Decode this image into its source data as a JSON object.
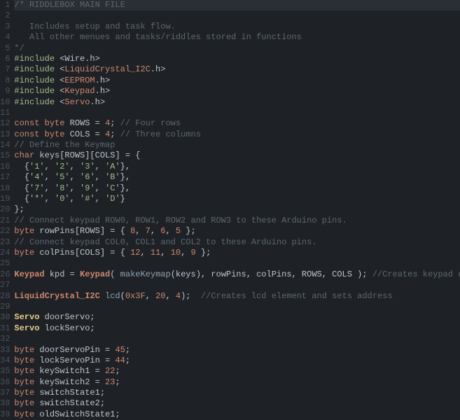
{
  "lines": [
    {
      "n": 1,
      "hl": true,
      "tokens": [
        {
          "t": "/* RIDDLEBOX MAIN FILE",
          "c": "c-comment"
        }
      ]
    },
    {
      "n": 2,
      "tokens": []
    },
    {
      "n": 3,
      "tokens": [
        {
          "t": "   Includes setup and task flow.",
          "c": "c-comment"
        }
      ]
    },
    {
      "n": 4,
      "tokens": [
        {
          "t": "   All other menues and tasks/riddles stored in functions",
          "c": "c-comment"
        }
      ]
    },
    {
      "n": 5,
      "tokens": [
        {
          "t": "*/",
          "c": "c-comment"
        }
      ]
    },
    {
      "n": 6,
      "tokens": [
        {
          "t": "#include ",
          "c": "c-pre"
        },
        {
          "t": "<",
          "c": "c-op"
        },
        {
          "t": "Wire",
          "c": "c-libw"
        },
        {
          "t": ".h",
          "c": "c-libw"
        },
        {
          "t": ">",
          "c": "c-op"
        }
      ]
    },
    {
      "n": 7,
      "tokens": [
        {
          "t": "#include ",
          "c": "c-pre"
        },
        {
          "t": "<",
          "c": "c-op"
        },
        {
          "t": "LiquidCrystal_I2C",
          "c": "c-lib"
        },
        {
          "t": ".h",
          "c": "c-libw"
        },
        {
          "t": ">",
          "c": "c-op"
        }
      ]
    },
    {
      "n": 8,
      "tokens": [
        {
          "t": "#include ",
          "c": "c-pre"
        },
        {
          "t": "<",
          "c": "c-op"
        },
        {
          "t": "EEPROM",
          "c": "c-lib"
        },
        {
          "t": ".h",
          "c": "c-libw"
        },
        {
          "t": ">",
          "c": "c-op"
        }
      ]
    },
    {
      "n": 9,
      "tokens": [
        {
          "t": "#include ",
          "c": "c-pre"
        },
        {
          "t": "<",
          "c": "c-op"
        },
        {
          "t": "Keypad",
          "c": "c-lib"
        },
        {
          "t": ".h",
          "c": "c-libw"
        },
        {
          "t": ">",
          "c": "c-op"
        }
      ]
    },
    {
      "n": 10,
      "tokens": [
        {
          "t": "#include ",
          "c": "c-pre"
        },
        {
          "t": "<",
          "c": "c-op"
        },
        {
          "t": "Servo",
          "c": "c-lib"
        },
        {
          "t": ".h",
          "c": "c-libw"
        },
        {
          "t": ">",
          "c": "c-op"
        }
      ]
    },
    {
      "n": 11,
      "tokens": []
    },
    {
      "n": 12,
      "tokens": [
        {
          "t": "const ",
          "c": "c-keyword"
        },
        {
          "t": "byte",
          "c": "c-type"
        },
        {
          "t": " ROWS ",
          "c": "c-id"
        },
        {
          "t": "=",
          "c": "c-op"
        },
        {
          "t": " ",
          "c": "c-id"
        },
        {
          "t": "4",
          "c": "c-num"
        },
        {
          "t": "; ",
          "c": "c-op"
        },
        {
          "t": "// Four rows",
          "c": "c-comment"
        }
      ]
    },
    {
      "n": 13,
      "tokens": [
        {
          "t": "const ",
          "c": "c-keyword"
        },
        {
          "t": "byte",
          "c": "c-type"
        },
        {
          "t": " COLS ",
          "c": "c-id"
        },
        {
          "t": "=",
          "c": "c-op"
        },
        {
          "t": " ",
          "c": "c-id"
        },
        {
          "t": "4",
          "c": "c-num"
        },
        {
          "t": "; ",
          "c": "c-op"
        },
        {
          "t": "// Three columns",
          "c": "c-comment"
        }
      ]
    },
    {
      "n": 14,
      "tokens": [
        {
          "t": "// Define the Keymap",
          "c": "c-comment"
        }
      ]
    },
    {
      "n": 15,
      "tokens": [
        {
          "t": "char",
          "c": "c-type"
        },
        {
          "t": " keys[ROWS][COLS] ",
          "c": "c-id"
        },
        {
          "t": "=",
          "c": "c-op"
        },
        {
          "t": " {",
          "c": "c-op"
        }
      ]
    },
    {
      "n": 16,
      "tokens": [
        {
          "t": "  {",
          "c": "c-op"
        },
        {
          "t": "'1'",
          "c": "c-str"
        },
        {
          "t": ", ",
          "c": "c-op"
        },
        {
          "t": "'2'",
          "c": "c-str"
        },
        {
          "t": ", ",
          "c": "c-op"
        },
        {
          "t": "'3'",
          "c": "c-str"
        },
        {
          "t": ", ",
          "c": "c-op"
        },
        {
          "t": "'A'",
          "c": "c-str"
        },
        {
          "t": "},",
          "c": "c-op"
        }
      ]
    },
    {
      "n": 17,
      "tokens": [
        {
          "t": "  {",
          "c": "c-op"
        },
        {
          "t": "'4'",
          "c": "c-str"
        },
        {
          "t": ", ",
          "c": "c-op"
        },
        {
          "t": "'5'",
          "c": "c-str"
        },
        {
          "t": ", ",
          "c": "c-op"
        },
        {
          "t": "'6'",
          "c": "c-str"
        },
        {
          "t": ", ",
          "c": "c-op"
        },
        {
          "t": "'B'",
          "c": "c-str"
        },
        {
          "t": "},",
          "c": "c-op"
        }
      ]
    },
    {
      "n": 18,
      "tokens": [
        {
          "t": "  {",
          "c": "c-op"
        },
        {
          "t": "'7'",
          "c": "c-str"
        },
        {
          "t": ", ",
          "c": "c-op"
        },
        {
          "t": "'8'",
          "c": "c-str"
        },
        {
          "t": ", ",
          "c": "c-op"
        },
        {
          "t": "'9'",
          "c": "c-str"
        },
        {
          "t": ", ",
          "c": "c-op"
        },
        {
          "t": "'C'",
          "c": "c-str"
        },
        {
          "t": "},",
          "c": "c-op"
        }
      ]
    },
    {
      "n": 19,
      "tokens": [
        {
          "t": "  {",
          "c": "c-op"
        },
        {
          "t": "'*'",
          "c": "c-str"
        },
        {
          "t": ", ",
          "c": "c-op"
        },
        {
          "t": "'0'",
          "c": "c-str"
        },
        {
          "t": ", ",
          "c": "c-op"
        },
        {
          "t": "'#'",
          "c": "c-str"
        },
        {
          "t": ", ",
          "c": "c-op"
        },
        {
          "t": "'D'",
          "c": "c-str"
        },
        {
          "t": "}",
          "c": "c-op"
        }
      ]
    },
    {
      "n": 20,
      "tokens": [
        {
          "t": "};",
          "c": "c-op"
        }
      ]
    },
    {
      "n": 21,
      "tokens": [
        {
          "t": "// Connect keypad ROW0, ROW1, ROW2 and ROW3 to these Arduino pins.",
          "c": "c-comment"
        }
      ]
    },
    {
      "n": 22,
      "tokens": [
        {
          "t": "byte",
          "c": "c-type"
        },
        {
          "t": " rowPins[ROWS] ",
          "c": "c-id"
        },
        {
          "t": "=",
          "c": "c-op"
        },
        {
          "t": " { ",
          "c": "c-op"
        },
        {
          "t": "8",
          "c": "c-num"
        },
        {
          "t": ", ",
          "c": "c-op"
        },
        {
          "t": "7",
          "c": "c-num"
        },
        {
          "t": ", ",
          "c": "c-op"
        },
        {
          "t": "6",
          "c": "c-num"
        },
        {
          "t": ", ",
          "c": "c-op"
        },
        {
          "t": "5",
          "c": "c-num"
        },
        {
          "t": " };",
          "c": "c-op"
        }
      ]
    },
    {
      "n": 23,
      "tokens": [
        {
          "t": "// Connect keypad COL0, COL1 and COL2 to these Arduino pins.",
          "c": "c-comment"
        }
      ]
    },
    {
      "n": 24,
      "tokens": [
        {
          "t": "byte",
          "c": "c-type"
        },
        {
          "t": " colPins[COLS] ",
          "c": "c-id"
        },
        {
          "t": "=",
          "c": "c-op"
        },
        {
          "t": " { ",
          "c": "c-op"
        },
        {
          "t": "12",
          "c": "c-num"
        },
        {
          "t": ", ",
          "c": "c-op"
        },
        {
          "t": "11",
          "c": "c-num"
        },
        {
          "t": ", ",
          "c": "c-op"
        },
        {
          "t": "10",
          "c": "c-num"
        },
        {
          "t": ", ",
          "c": "c-op"
        },
        {
          "t": "9",
          "c": "c-num"
        },
        {
          "t": " };",
          "c": "c-op"
        }
      ]
    },
    {
      "n": 25,
      "tokens": []
    },
    {
      "n": 26,
      "tokens": [
        {
          "t": "Keypad",
          "c": "c-class2"
        },
        {
          "t": " kpd ",
          "c": "c-id"
        },
        {
          "t": "=",
          "c": "c-op"
        },
        {
          "t": " ",
          "c": "c-id"
        },
        {
          "t": "Keypad",
          "c": "c-class2"
        },
        {
          "t": "( ",
          "c": "c-op"
        },
        {
          "t": "makeKeymap",
          "c": "c-func"
        },
        {
          "t": "(keys), rowPins, colPins, ROWS, COLS ); ",
          "c": "c-id"
        },
        {
          "t": "//Creates keypad element",
          "c": "c-comment"
        }
      ]
    },
    {
      "n": 27,
      "tokens": []
    },
    {
      "n": 28,
      "tokens": [
        {
          "t": "LiquidCrystal_I2C",
          "c": "c-class2"
        },
        {
          "t": " ",
          "c": "c-id"
        },
        {
          "t": "lcd",
          "c": "c-func"
        },
        {
          "t": "(",
          "c": "c-op"
        },
        {
          "t": "0x3F",
          "c": "c-hex"
        },
        {
          "t": ", ",
          "c": "c-op"
        },
        {
          "t": "20",
          "c": "c-num"
        },
        {
          "t": ", ",
          "c": "c-op"
        },
        {
          "t": "4",
          "c": "c-num"
        },
        {
          "t": ");  ",
          "c": "c-op"
        },
        {
          "t": "//Creates lcd element and sets address",
          "c": "c-comment"
        }
      ]
    },
    {
      "n": 29,
      "tokens": []
    },
    {
      "n": 30,
      "tokens": [
        {
          "t": "Servo",
          "c": "c-class"
        },
        {
          "t": " doorServo;",
          "c": "c-id"
        }
      ]
    },
    {
      "n": 31,
      "tokens": [
        {
          "t": "Servo",
          "c": "c-class"
        },
        {
          "t": " lockServo;",
          "c": "c-id"
        }
      ]
    },
    {
      "n": 32,
      "tokens": []
    },
    {
      "n": 33,
      "tokens": [
        {
          "t": "byte",
          "c": "c-type"
        },
        {
          "t": " doorServoPin ",
          "c": "c-id"
        },
        {
          "t": "=",
          "c": "c-op"
        },
        {
          "t": " ",
          "c": "c-id"
        },
        {
          "t": "45",
          "c": "c-num"
        },
        {
          "t": ";",
          "c": "c-op"
        }
      ]
    },
    {
      "n": 34,
      "tokens": [
        {
          "t": "byte",
          "c": "c-type"
        },
        {
          "t": " lockServoPin ",
          "c": "c-id"
        },
        {
          "t": "=",
          "c": "c-op"
        },
        {
          "t": " ",
          "c": "c-id"
        },
        {
          "t": "44",
          "c": "c-num"
        },
        {
          "t": ";",
          "c": "c-op"
        }
      ]
    },
    {
      "n": 35,
      "tokens": [
        {
          "t": "byte",
          "c": "c-type"
        },
        {
          "t": " keySwitch1 ",
          "c": "c-id"
        },
        {
          "t": "=",
          "c": "c-op"
        },
        {
          "t": " ",
          "c": "c-id"
        },
        {
          "t": "22",
          "c": "c-num"
        },
        {
          "t": ";",
          "c": "c-op"
        }
      ]
    },
    {
      "n": 36,
      "tokens": [
        {
          "t": "byte",
          "c": "c-type"
        },
        {
          "t": " keySwitch2 ",
          "c": "c-id"
        },
        {
          "t": "=",
          "c": "c-op"
        },
        {
          "t": " ",
          "c": "c-id"
        },
        {
          "t": "23",
          "c": "c-num"
        },
        {
          "t": ";",
          "c": "c-op"
        }
      ]
    },
    {
      "n": 37,
      "tokens": [
        {
          "t": "byte",
          "c": "c-type"
        },
        {
          "t": " switchState1;",
          "c": "c-id"
        }
      ]
    },
    {
      "n": 38,
      "tokens": [
        {
          "t": "byte",
          "c": "c-type"
        },
        {
          "t": " switchState2;",
          "c": "c-id"
        }
      ]
    },
    {
      "n": 39,
      "tokens": [
        {
          "t": "byte",
          "c": "c-type"
        },
        {
          "t": " oldSwitchState1;",
          "c": "c-id"
        }
      ]
    }
  ]
}
